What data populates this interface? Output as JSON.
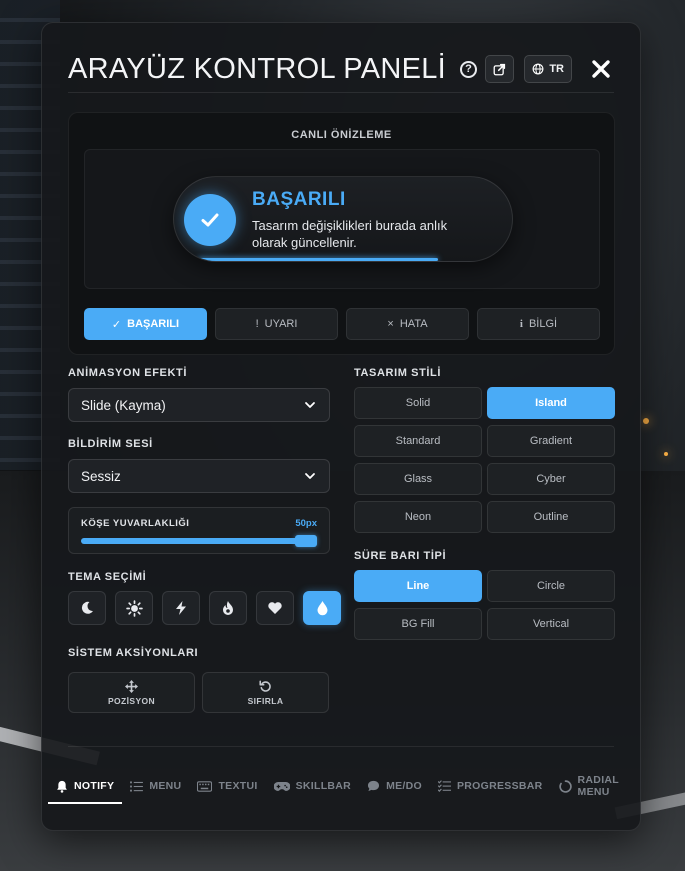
{
  "header": {
    "title": "ARAYÜZ KONTROL PANELİ",
    "lang_label": "TR"
  },
  "preview": {
    "label": "CANLI ÖNİZLEME",
    "notification": {
      "title": "BAŞARILI",
      "message": "Tasarım değişiklikleri burada anlık olarak güncellenir."
    },
    "types": [
      {
        "label": "BAŞARILI",
        "glyph": "✓",
        "active": true
      },
      {
        "label": "UYARI",
        "glyph": "!",
        "active": false
      },
      {
        "label": "HATA",
        "glyph": "×",
        "active": false
      },
      {
        "label": "BİLGİ",
        "glyph": "i",
        "active": false
      }
    ]
  },
  "animation": {
    "label": "ANİMASYON EFEKTİ",
    "value": "Slide (Kayma)"
  },
  "sound": {
    "label": "BİLDİRİM SESİ",
    "value": "Sessiz"
  },
  "radius": {
    "label": "KÖŞE YUVARLAKLIĞI",
    "value_text": "50px",
    "fraction": 1.0
  },
  "theme": {
    "label": "TEMA SEÇİMİ",
    "options": [
      "moon-icon",
      "sun-icon",
      "bolt-icon",
      "fire-icon",
      "heart-icon",
      "drop-icon"
    ],
    "active_index": 5
  },
  "system": {
    "label": "SİSTEM AKSİYONLARI",
    "position_label": "POZİSYON",
    "reset_label": "SIFIRLA"
  },
  "design": {
    "label": "TASARIM STİLİ",
    "options": [
      "Solid",
      "Island",
      "Standard",
      "Gradient",
      "Glass",
      "Cyber",
      "Neon",
      "Outline"
    ],
    "active": "Island"
  },
  "bar_type": {
    "label": "SÜRE BARI TİPİ",
    "options": [
      "Line",
      "Circle",
      "BG Fill",
      "Vertical"
    ],
    "active": "Line"
  },
  "tabs": [
    {
      "label": "NOTIFY",
      "icon": "bell-icon",
      "active": true
    },
    {
      "label": "MENU",
      "icon": "list-icon",
      "active": false
    },
    {
      "label": "TEXTUI",
      "icon": "keyboard-icon",
      "active": false
    },
    {
      "label": "SKILLBAR",
      "icon": "gamepad-icon",
      "active": false
    },
    {
      "label": "ME/DO",
      "icon": "chat-icon",
      "active": false
    },
    {
      "label": "PROGRESSBAR",
      "icon": "checklist-icon",
      "active": false
    },
    {
      "label_line1": "RADIAL",
      "label_line2": "MENU",
      "icon": "radial-icon",
      "active": false
    }
  ],
  "colors": {
    "accent": "#4aabf6",
    "panel": "#16181b"
  }
}
